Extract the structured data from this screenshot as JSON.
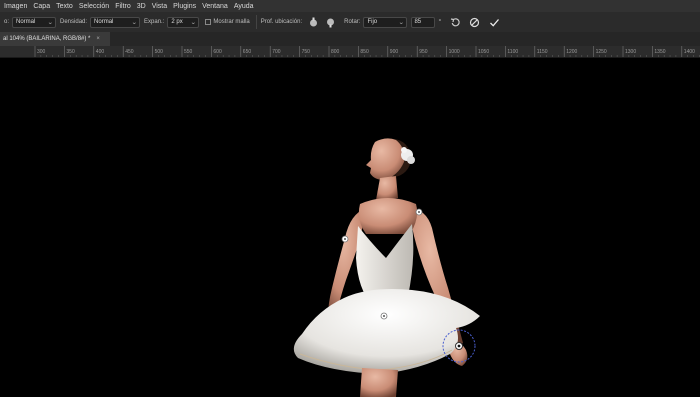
{
  "menu": [
    "Imagen",
    "Capa",
    "Texto",
    "Selección",
    "Filtro",
    "3D",
    "Vista",
    "Plugins",
    "Ventana",
    "Ayuda"
  ],
  "options": {
    "mode_value": "Normal",
    "density_label": "Densidad:",
    "density_value": "Normal",
    "expansion_label": "Expan.:",
    "expansion_value": "2 px",
    "show_mesh_label": "Mostrar malla",
    "pin_depth_label": "Prof. ubicación:",
    "rotate_label": "Rotar:",
    "rotate_value": "Fijo",
    "angle_value": "85",
    "angle_unit": "°"
  },
  "tab": {
    "title": "al 104% (BAILARINA, RGB/8#) *",
    "close": "×"
  },
  "ruler": {
    "ticks": [
      "300",
      "350",
      "400",
      "450",
      "500",
      "550",
      "600",
      "650",
      "700",
      "750",
      "800",
      "850",
      "900",
      "950",
      "1000",
      "1050",
      "1100",
      "1150",
      "1200",
      "1250",
      "1300",
      "1350",
      "1400"
    ]
  },
  "colors": {
    "menubar": "#323232",
    "options_bar": "#2b2b2b",
    "canvas": "#000000",
    "pin_ring": "#4a5fd0"
  }
}
